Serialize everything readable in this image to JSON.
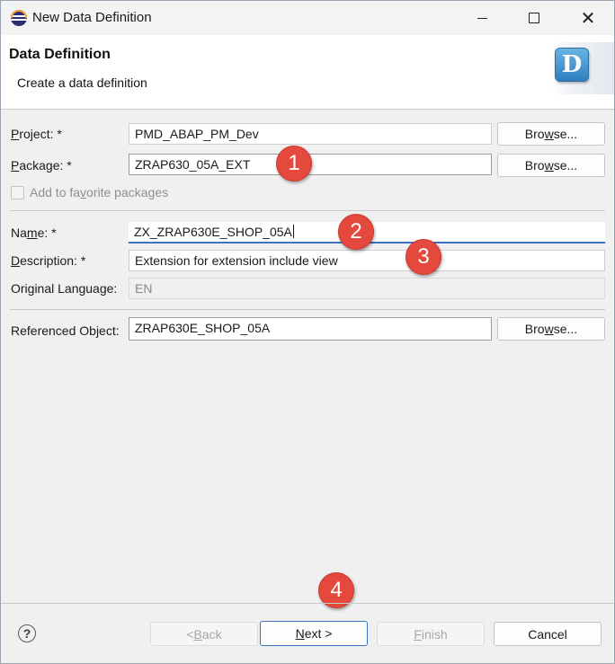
{
  "window": {
    "title": "New Data Definition"
  },
  "banner": {
    "title": "Data Definition",
    "subtitle": "Create a data definition",
    "icon_letter": "D",
    "icon": "data-definition-icon"
  },
  "form": {
    "project": {
      "label_key": "P",
      "label_rest": "roject: *",
      "value": "PMD_ABAP_PM_Dev"
    },
    "package": {
      "label_key": "P",
      "label_rest": "ackage: *",
      "value": "ZRAP630_05A_EXT"
    },
    "favorites": {
      "label_pre": "Add to fa",
      "label_key": "v",
      "label_post": "orite packages",
      "checked": false
    },
    "name": {
      "label_pre": "Na",
      "label_key": "m",
      "label_post": "e: *",
      "value": "ZX_ZRAP630E_SHOP_05A"
    },
    "description": {
      "label_key": "D",
      "label_rest": "escription: *",
      "value": "Extension for extension include view"
    },
    "original_language": {
      "label": "Original Language:",
      "value": "EN"
    },
    "referenced_object": {
      "label": "Referenced Object:",
      "value": "ZRAP630E_SHOP_05A"
    },
    "browse": {
      "pre": "Bro",
      "key": "w",
      "post": "se..."
    }
  },
  "markers": [
    "1",
    "2",
    "3",
    "4"
  ],
  "footer": {
    "help": "?",
    "back": {
      "pre": "< ",
      "key": "B",
      "post": "ack"
    },
    "next": {
      "key": "N",
      "post": "ext >"
    },
    "finish": {
      "key": "F",
      "post": "inish"
    },
    "cancel": "Cancel"
  },
  "colors": {
    "marker": "#e5483d",
    "focus": "#3a72c4"
  }
}
